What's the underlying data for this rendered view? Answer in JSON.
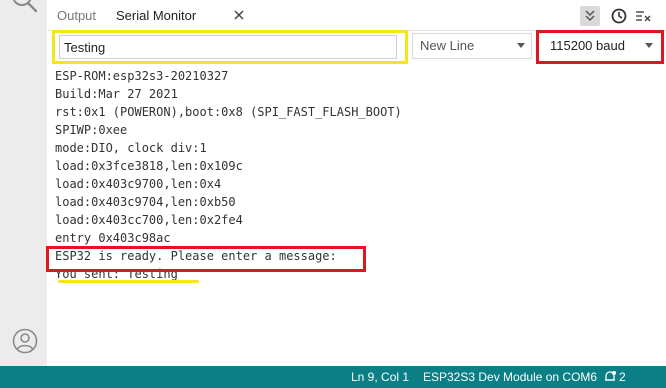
{
  "tabs": {
    "output_label": "Output",
    "serial_label": "Serial Monitor"
  },
  "input": {
    "message_value": "Testing"
  },
  "line_ending": {
    "selected": "New Line"
  },
  "baud_rate": {
    "selected": "115200 baud"
  },
  "output_lines": [
    "ESP-ROM:esp32s3-20210327",
    "Build:Mar 27 2021",
    "rst:0x1 (POWERON),boot:0x8 (SPI_FAST_FLASH_BOOT)",
    "SPIWP:0xee",
    "mode:DIO, clock div:1",
    "load:0x3fce3818,len:0x109c",
    "load:0x403c9700,len:0x4",
    "load:0x403c9704,len:0xb50",
    "load:0x403cc700,len:0x2fe4",
    "entry 0x403c98ac",
    "ESP32 is ready. Please enter a message:",
    "You sent: Testing"
  ],
  "status": {
    "position": "Ln 9, Col 1",
    "board": "ESP32S3 Dev Module on COM6",
    "notifications": "2"
  },
  "colors": {
    "highlight_yellow": "#f3e71b",
    "highlight_red": "#e0151d",
    "status_bar": "#0b7f86"
  },
  "icons": {
    "search": "search-icon",
    "account": "account-icon",
    "close": "close-icon",
    "collapse": "chevron-double-down-icon",
    "timestamp": "clock-icon",
    "clear": "clear-output-icon",
    "notifications": "bell-icon"
  }
}
